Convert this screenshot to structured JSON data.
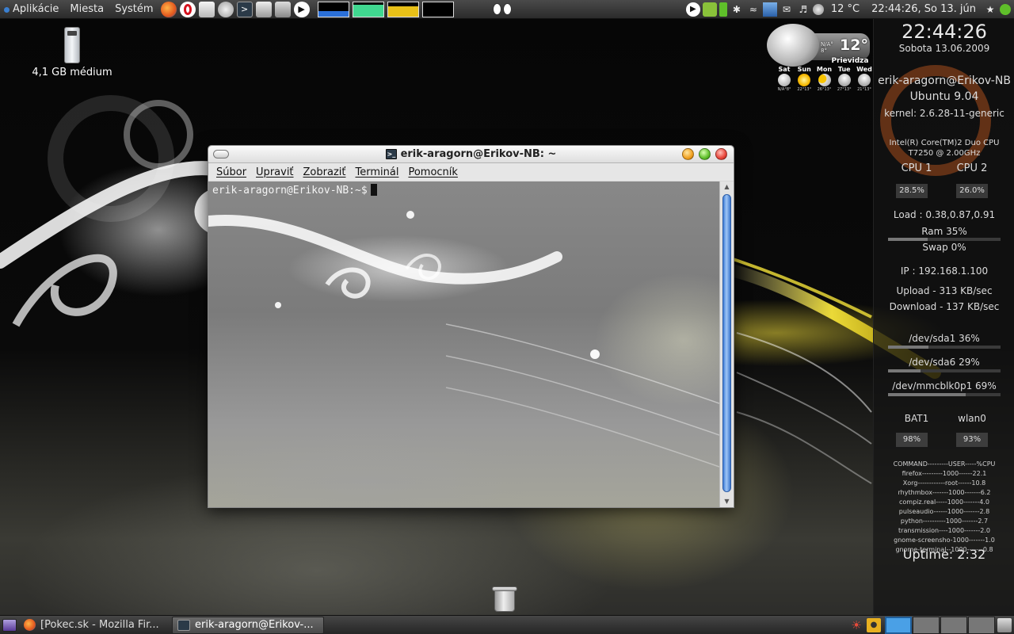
{
  "top_panel": {
    "menus": [
      "Aplikácie",
      "Miesta",
      "Systém"
    ],
    "temperature": "12 °C",
    "datetime": "22:44:26, So 13. jún"
  },
  "desktop": {
    "drive_label": "4,1 GB médium"
  },
  "terminal": {
    "title": "erik-aragorn@Erikov-NB: ~",
    "menu": [
      "Súbor",
      "Upraviť",
      "Zobraziť",
      "Terminál",
      "Pomocník"
    ],
    "prompt": "erik-aragorn@Erikov-NB:~$"
  },
  "weather": {
    "current_small": "N/A°\n8°",
    "current_temp": "12°",
    "condition": "Prievidza",
    "days": [
      {
        "name": "Sat",
        "temps": "N/A°8°"
      },
      {
        "name": "Sun",
        "temps": "22°13°"
      },
      {
        "name": "Mon",
        "temps": "26°13°"
      },
      {
        "name": "Tue",
        "temps": "27°13°"
      },
      {
        "name": "Wed",
        "temps": "21°13°"
      }
    ]
  },
  "conky": {
    "clock": "22:44:26",
    "date": "Sobota 13.06.2009",
    "user": "erik-aragorn@Erikov-NB",
    "os": "Ubuntu 9.04",
    "kernel": "kernel: 2.6.28-11-generic",
    "cpu_model": "Intel(R) Core(TM)2 Duo CPU T7250  @ 2.00GHz",
    "cpu1_label": "CPU 1",
    "cpu2_label": "CPU 2",
    "cpu1_value": "28.5%",
    "cpu2_value": "26.0%",
    "load": "Load : 0.38,0.87,0.91",
    "ram": "Ram 35%",
    "swap": "Swap 0%",
    "ip": "IP : 192.168.1.100",
    "upload": "Upload - 313 KB/sec",
    "download": "Download - 137 KB/sec",
    "sda1": "/dev/sda1 36%",
    "sda6": "/dev/sda6 29%",
    "mmc": "/dev/mmcblk0p1 69%",
    "bat_label": "BAT1",
    "wlan_label": "wlan0",
    "bat_value": "98%",
    "wlan_value": "93%",
    "processes": "COMMAND---------USER-----%CPU\nfirefox---------1000------22.1\nXorg------------root------10.8\nrhythmbox-------1000-------6.2\ncompiz.real-----1000-------4.0\npulseaudio------1000-------2.8\npython----------1000-------2.7\ntransmission----1000-------2.0\ngnome-screensho-1000-------1.0\ngnome-terminal--1000-------0.8",
    "uptime": "Uptime: 2:32"
  },
  "bottom_panel": {
    "tasks": [
      "[Pokec.sk - Mozilla Fir...",
      "erik-aragorn@Erikov-..."
    ]
  },
  "levels": {
    "ram": 0.35,
    "swap": 0.0,
    "sda1": 0.36,
    "sda6": 0.29,
    "mmc": 0.69
  },
  "colors": {
    "accent": "#4aa0e6",
    "status_green": "#5fbf2a"
  }
}
